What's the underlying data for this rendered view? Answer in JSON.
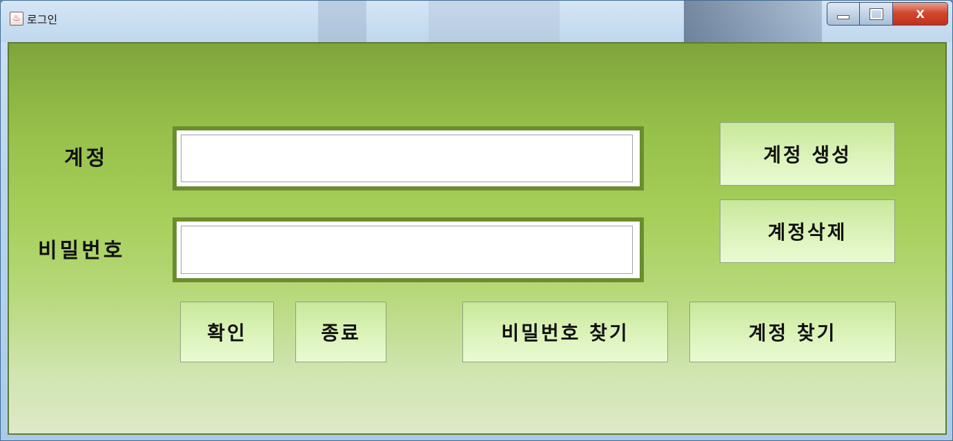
{
  "window": {
    "title": "로그인",
    "close_label": "X"
  },
  "form": {
    "account_label": "계정",
    "password_label": "비밀번호",
    "account_value": "",
    "password_value": ""
  },
  "buttons": {
    "create_account": "계정 생성",
    "delete_account": "계정삭제",
    "confirm": "확인",
    "exit": "종료",
    "find_password": "비밀번호 찾기",
    "find_account": "계정 찾기"
  }
}
